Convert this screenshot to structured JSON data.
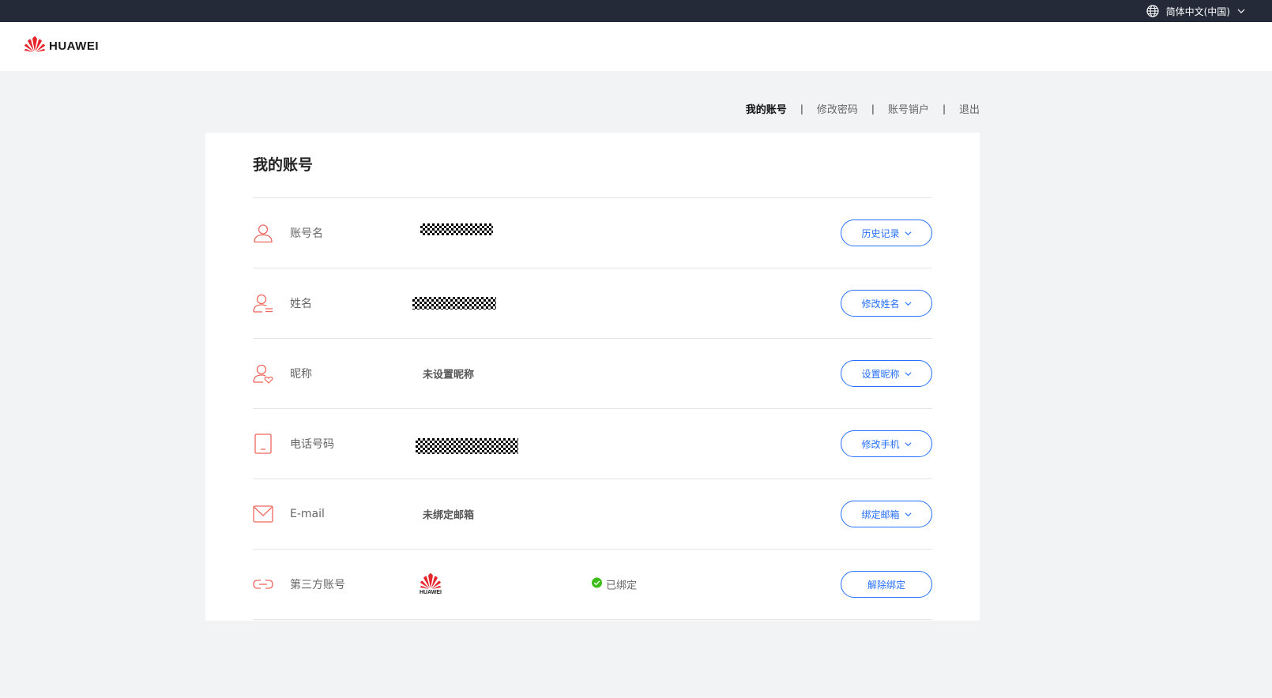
{
  "topbar": {
    "language_label": "简体中文(中国)",
    "globe_icon": "globe-icon",
    "dropdown_icon": "chevron-down-icon"
  },
  "header": {
    "logo_text": "HUAWEI",
    "brand_color": "#e5272d"
  },
  "subnav": {
    "items": [
      {
        "label": "我的账号",
        "active": true
      },
      {
        "label": "修改密码",
        "active": false
      },
      {
        "label": "账号销户",
        "active": false
      },
      {
        "label": "退出",
        "active": false
      }
    ],
    "separator": "|"
  },
  "card": {
    "title": "我的账号",
    "rows": [
      {
        "icon": "user-icon",
        "label": "账号名",
        "value": "",
        "masked": true,
        "action": "历史记录",
        "action_has_dropdown": true
      },
      {
        "icon": "user-name-icon",
        "label": "姓名",
        "value": "",
        "masked": true,
        "action": "修改姓名",
        "action_has_dropdown": true
      },
      {
        "icon": "user-heart-icon",
        "label": "昵称",
        "value": "未设置昵称",
        "masked": false,
        "action": "设置昵称",
        "action_has_dropdown": true
      },
      {
        "icon": "phone-icon",
        "label": "电话号码",
        "value": "",
        "masked": true,
        "action": "修改手机",
        "action_has_dropdown": true
      },
      {
        "icon": "mail-icon",
        "label": "E-mail",
        "value": "未绑定邮箱",
        "masked": false,
        "action": "绑定邮箱",
        "action_has_dropdown": true
      },
      {
        "icon": "link-icon",
        "label": "第三方账号",
        "value_logo_text": "HUAWEI",
        "status": "已绑定",
        "status_icon": "check-circle-icon",
        "action": "解除绑定",
        "action_has_dropdown": false
      }
    ]
  },
  "colors": {
    "accent": "#256fff",
    "icon_red": "#f0685f",
    "success": "#3dbd1a",
    "topbar_bg": "#242a38",
    "page_bg": "#f2f3f5"
  }
}
